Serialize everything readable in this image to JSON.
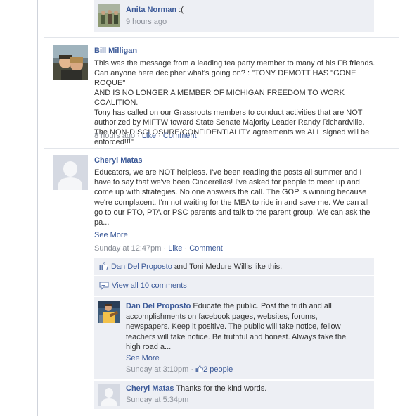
{
  "top_comment": {
    "author": "Anita Norman",
    "text": ":(",
    "time": "9 hours ago"
  },
  "post1": {
    "author": "Bill Milligan",
    "lines": [
      "This was the message from a leading tea party member to many of his FB friends.",
      "Can anyone here decipher what's going on? : \"TONY DEMOTT HAS \"GONE ROQUE\"",
      "AND IS NO LONGER A MEMBER OF MICHIGAN FREEDOM TO WORK COALITION.",
      "Tony has called on our Grassroots members to conduct activities that are NOT",
      "authorized by MIFTW toward State Senate Majority Leader Randy Richardville.",
      "The NON-DISCLOSURE/CONFIDENTIALITY agreements we ALL signed will be",
      "enforced!!!\""
    ],
    "time": "8 hours ago",
    "sep": "·",
    "like": "Like",
    "comment": "Comment"
  },
  "post2": {
    "author": "Cheryl Matas",
    "lines": [
      "Educators, we are NOT helpless. I've been reading the posts all summer and I",
      "have to say that we've been Cinderellas! I've asked for people to meet up and",
      "come up with strategies. No one answers the call. The GOP is winning because",
      "we're complacent. I'm not waiting for the MEA to ride in and save me. We can all",
      "go to our PTO, PTA or PSC parents and talk to the parent group. We can ask the",
      "pa..."
    ],
    "see_more": "See More",
    "time": "Sunday at 12:47pm",
    "sep": "·",
    "like": "Like",
    "comment": "Comment",
    "likes": {
      "name": "Dan Del Proposto",
      "rest": " and Toni Medure Willis like this."
    },
    "view_all": "View all 10 comments",
    "comments": [
      {
        "author": "Dan Del Proposto",
        "lines": [
          "Educate the public. Post the truth and all",
          "accomplishments on facebook pages, websites, forums,",
          "newspapers. Keep it positive. The public will take notice, fellow",
          "teachers will take notice. Be truthful and honest. Always take the",
          "high road a..."
        ],
        "see_more": "See More",
        "time": "Sunday at 3:10pm",
        "sep": "·",
        "like_count": "2 people"
      },
      {
        "author": "Cheryl Matas",
        "text": "Thanks for the kind words.",
        "time": "Sunday at 5:34pm"
      }
    ]
  },
  "colors": {
    "link": "#3b5998",
    "meta": "#8a8f98",
    "comment_bg": "#edeff4"
  },
  "icons": [
    "thumbs-up-icon",
    "comment-bubble-icon",
    "thumbs-up-small-icon"
  ]
}
